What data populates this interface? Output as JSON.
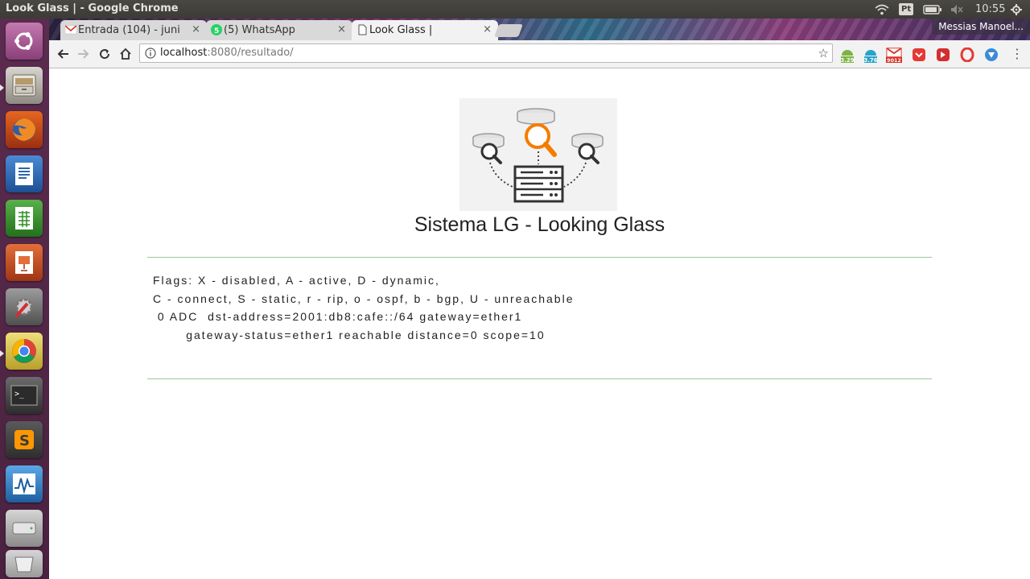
{
  "os_panel": {
    "window_title": "Look Glass | - Google Chrome",
    "keyboard_layout": "Pt",
    "clock": "10:55",
    "indicators": [
      "wifi-icon",
      "keyboard-layout-indicator",
      "battery-icon",
      "volume-muted-icon",
      "power-gear-icon"
    ]
  },
  "launcher": {
    "items": [
      {
        "name": "ubuntu-dash",
        "icon": "ubuntu-logo-icon"
      },
      {
        "name": "files",
        "icon": "file-cabinet-icon"
      },
      {
        "name": "firefox",
        "icon": "firefox-icon"
      },
      {
        "name": "libreoffice-writer",
        "icon": "writer-icon"
      },
      {
        "name": "libreoffice-calc",
        "icon": "calc-icon"
      },
      {
        "name": "libreoffice-impress",
        "icon": "impress-icon"
      },
      {
        "name": "system-settings",
        "icon": "settings-wrench-icon"
      },
      {
        "name": "google-chrome",
        "icon": "chrome-icon"
      },
      {
        "name": "terminal",
        "icon": "terminal-icon"
      },
      {
        "name": "sublime-text",
        "icon": "sublime-icon"
      },
      {
        "name": "system-monitor",
        "icon": "monitor-icon"
      },
      {
        "name": "disk",
        "icon": "disk-icon"
      },
      {
        "name": "trash",
        "icon": "trash-icon"
      }
    ]
  },
  "browser": {
    "tabs": [
      {
        "label": "Entrada (104) - juni",
        "favicon": "gmail-icon",
        "active": false
      },
      {
        "label": "(5) WhatsApp",
        "favicon": "whatsapp-icon",
        "active": false
      },
      {
        "label": "Look Glass |",
        "favicon": "page-icon",
        "active": true
      }
    ],
    "tab_close": "×",
    "profile_name": "Messias Manoel...",
    "url_host": "localhost",
    "url_rest": ":8080/resultado/",
    "extensions": [
      {
        "name": "android-ext",
        "badge": "3.29",
        "color": "#7cb342"
      },
      {
        "name": "cloud-ext",
        "badge": "3.76",
        "color": "#29a3c9"
      },
      {
        "name": "gmail-ext",
        "badge": "9012",
        "color": "#d93025"
      },
      {
        "name": "pocket-ext",
        "badge": "",
        "color": "#e53935"
      },
      {
        "name": "media-ext",
        "badge": "",
        "color": "#d32f2f"
      },
      {
        "name": "opera-ext",
        "badge": "",
        "color": "#e53935"
      },
      {
        "name": "shield-ext",
        "badge": "",
        "color": "#3b8bd6"
      }
    ]
  },
  "page": {
    "title": "Sistema LG - Looking Glass",
    "result_lines": [
      "Flags: X - disabled, A - active, D - dynamic,",
      "C - connect, S - static, r - rip, o - ospf, b - bgp, U - unreachable",
      " 0 ADC  dst-address=2001:db8:cafe::/64 gateway=ether1",
      "       gateway-status=ether1 reachable distance=0 scope=10"
    ]
  }
}
